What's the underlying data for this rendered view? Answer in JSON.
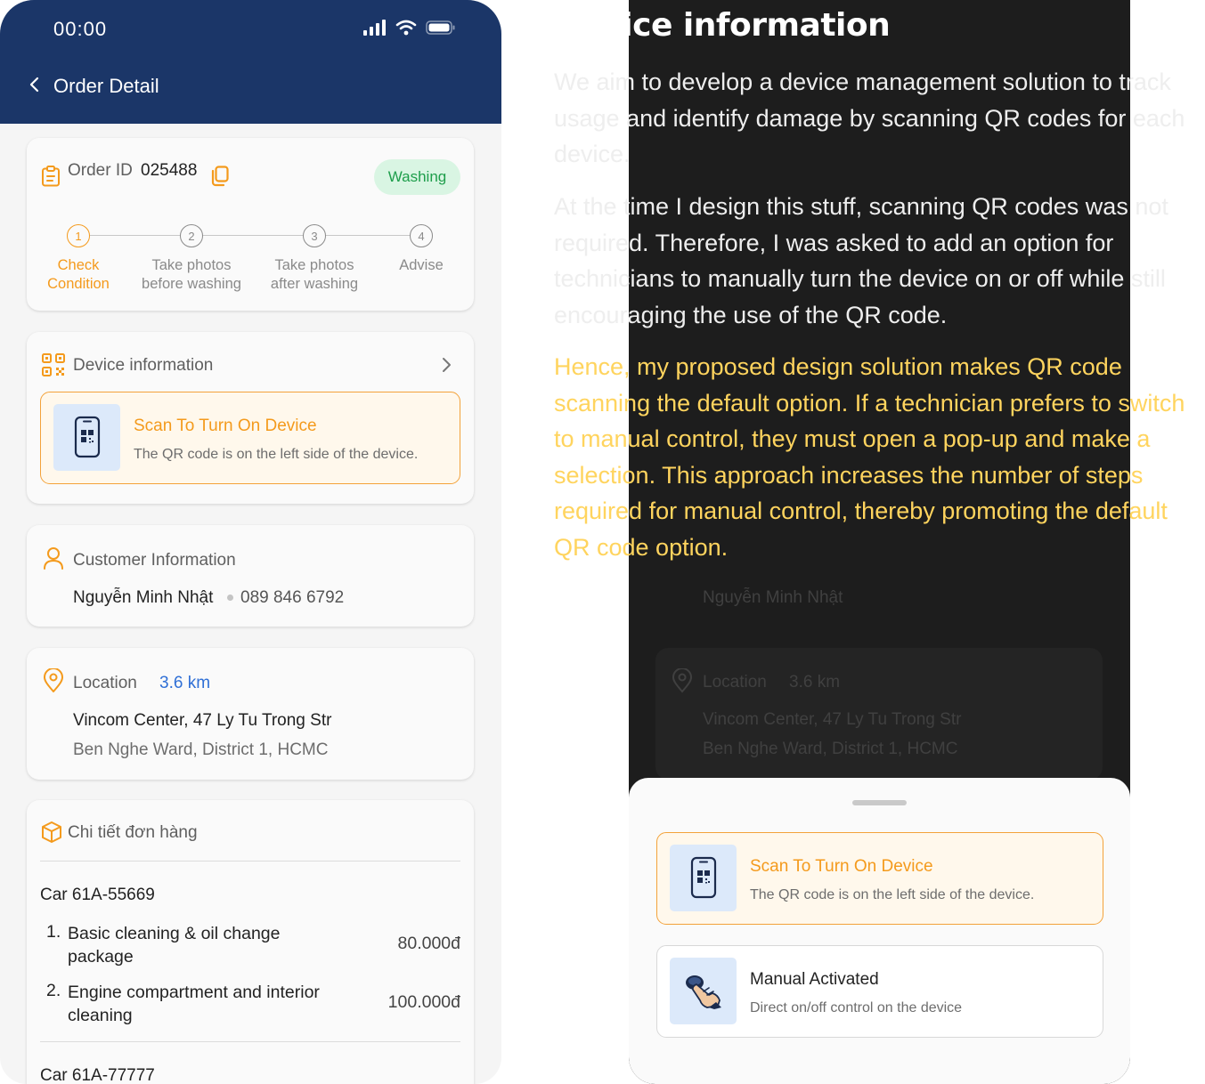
{
  "status_bar": {
    "time": "00:00"
  },
  "header": {
    "title": "Order Detail"
  },
  "order": {
    "id_label": "Order ID",
    "id_value": "025488",
    "status": "Washing",
    "steps": [
      {
        "number": "1",
        "line1": "Check",
        "line2": "Condition",
        "active": true
      },
      {
        "number": "2",
        "line1": "Take photos",
        "line2": "before washing",
        "active": false
      },
      {
        "number": "3",
        "line1": "Take photos",
        "line2": "after washing",
        "active": false
      },
      {
        "number": "4",
        "line1": "Advise",
        "line2": "",
        "active": false
      }
    ]
  },
  "device": {
    "title": "Device information",
    "scan_title": "Scan To Turn On Device",
    "scan_sub": "The QR code is on the left side of the device."
  },
  "customer": {
    "title": "Customer Information",
    "name": "Nguyễn Minh Nhật",
    "phone": "089 846 6792"
  },
  "location": {
    "title": "Location",
    "distance": "3.6 km",
    "line1": "Vincom Center, 47 Ly Tu Trong Str",
    "line2": "Ben Nghe Ward, District 1, HCMC"
  },
  "order_details": {
    "title": "Chi tiết đơn hàng",
    "car1": "Car 61A-55669",
    "items": [
      {
        "num": "1.",
        "line1": "Basic cleaning & oil change",
        "line2": "package",
        "price": "80.000đ"
      },
      {
        "num": "2.",
        "line1": "Engine compartment and interior",
        "line2": "cleaning",
        "price": "100.000đ"
      }
    ],
    "car2": "Car 61A-77777"
  },
  "explanation": {
    "title": "Device information",
    "p1": "We aim to develop a device management solution to track usage and identify damage by scanning QR codes for each device.",
    "p2": "At the time I design this stuff, scanning QR codes was not required. Therefore, I was asked to add an option for technicians to manually turn the device on or off while still encouraging the use of the QR code.",
    "p3": "Hence, my proposed design solution makes QR code scanning the default option. If a technician prefers to switch to manual control, they must open a pop-up and make a selection. This approach increases the number of steps required for manual control, thereby promoting the default QR code option."
  },
  "popup": {
    "scan_title": "Scan To Turn On Device",
    "scan_sub": "The QR code is on the left side of the device.",
    "manual_title": "Manual Activated",
    "manual_sub": "Direct on/off control on the device"
  },
  "colors": {
    "header": "#1b3668",
    "accent": "#f49a1c",
    "badge_bg": "#d9f5e3",
    "badge_text": "#1e9e4b",
    "link_blue": "#2f6fd6",
    "highlight_yellow": "#ffd45e"
  }
}
